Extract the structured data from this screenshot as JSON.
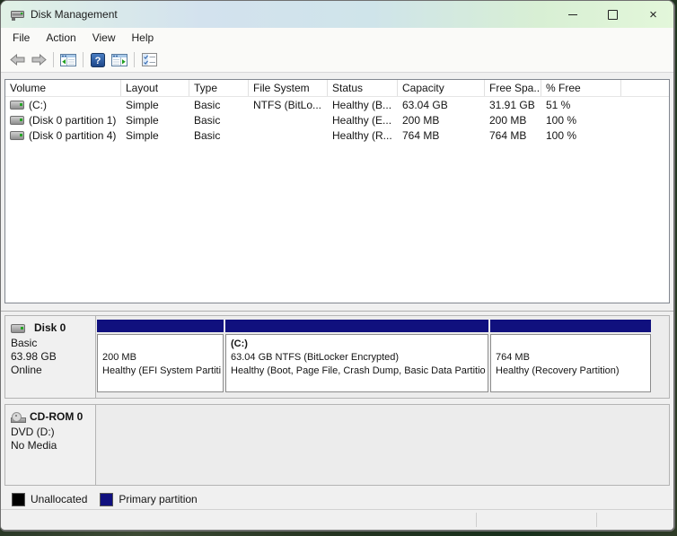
{
  "window": {
    "title": "Disk Management"
  },
  "icons": {
    "close_glyph": "×",
    "help_glyph": "?"
  },
  "menu": {
    "items": [
      {
        "label": "File"
      },
      {
        "label": "Action"
      },
      {
        "label": "View"
      },
      {
        "label": "Help"
      }
    ]
  },
  "toolbar": {
    "buttons": [
      "back",
      "forward",
      "show-console-tree",
      "help",
      "show-action-pane",
      "properties-list"
    ]
  },
  "volume_list": {
    "columns": [
      "Volume",
      "Layout",
      "Type",
      "File System",
      "Status",
      "Capacity",
      "Free Spa...",
      "% Free"
    ],
    "rows": [
      {
        "volume": "(C:)",
        "layout": "Simple",
        "type": "Basic",
        "file_system": "NTFS (BitLo...",
        "status": "Healthy (B...",
        "capacity": "63.04 GB",
        "free_space": "31.91 GB",
        "percent_free": "51 %"
      },
      {
        "volume": "(Disk 0 partition 1)",
        "layout": "Simple",
        "type": "Basic",
        "file_system": "",
        "status": "Healthy (E...",
        "capacity": "200 MB",
        "free_space": "200 MB",
        "percent_free": "100 %"
      },
      {
        "volume": "(Disk 0 partition 4)",
        "layout": "Simple",
        "type": "Basic",
        "file_system": "",
        "status": "Healthy (R...",
        "capacity": "764 MB",
        "free_space": "764 MB",
        "percent_free": "100 %"
      }
    ]
  },
  "graphical_view": {
    "disk0": {
      "name": "Disk 0",
      "type": "Basic",
      "capacity": "63.98 GB",
      "status": "Online",
      "partitions": [
        {
          "name": "",
          "info": "200 MB",
          "status": "Healthy (EFI System Partition)"
        },
        {
          "name": "(C:)",
          "info": "63.04 GB NTFS (BitLocker Encrypted)",
          "status": "Healthy (Boot, Page File, Crash Dump, Basic Data Partition)"
        },
        {
          "name": "",
          "info": "764 MB",
          "status": "Healthy (Recovery Partition)"
        }
      ]
    },
    "cdrom0": {
      "name": "CD-ROM 0",
      "type": "DVD (D:)",
      "media": "No Media"
    }
  },
  "legend": {
    "items": [
      {
        "label": "Unallocated",
        "color": "#000000"
      },
      {
        "label": "Primary partition",
        "color": "#10107E"
      }
    ]
  },
  "colors": {
    "primary_partition": "#10107E",
    "unallocated": "#000000"
  }
}
